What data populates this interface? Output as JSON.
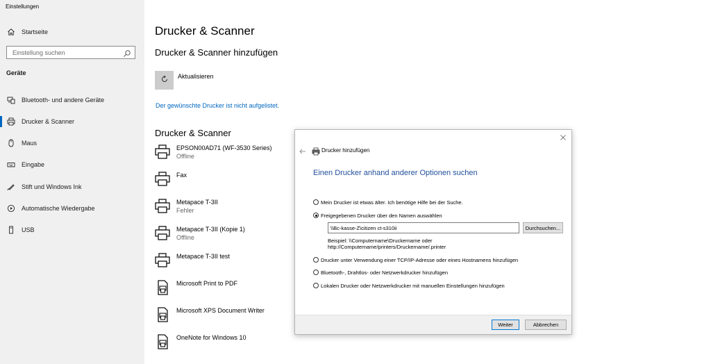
{
  "app": {
    "title": "Einstellungen"
  },
  "sidebar": {
    "home_label": "Startseite",
    "search_placeholder": "Einstellung suchen",
    "section": "Geräte",
    "items": [
      {
        "label": "Bluetooth- und andere Geräte",
        "icon": "bluetooth-devices-icon",
        "active": false
      },
      {
        "label": "Drucker & Scanner",
        "icon": "printer-icon",
        "active": true
      },
      {
        "label": "Maus",
        "icon": "mouse-icon",
        "active": false
      },
      {
        "label": "Eingabe",
        "icon": "keyboard-icon",
        "active": false
      },
      {
        "label": "Stift und Windows Ink",
        "icon": "pen-icon",
        "active": false
      },
      {
        "label": "Automatische Wiedergabe",
        "icon": "autoplay-icon",
        "active": false
      },
      {
        "label": "USB",
        "icon": "usb-icon",
        "active": false
      }
    ]
  },
  "main": {
    "title": "Drucker & Scanner",
    "add_title": "Drucker & Scanner hinzufügen",
    "refresh_label": "Aktualisieren",
    "not_listed_link": "Der gewünschte Drucker ist nicht aufgelistet.",
    "list_title": "Drucker & Scanner",
    "printers": [
      {
        "name": "EPSON00AD71 (WF-3530 Series)",
        "status": "Offline",
        "icon": "printer-icon"
      },
      {
        "name": "Fax",
        "status": "",
        "icon": "printer-icon"
      },
      {
        "name": "Metapace T-3II",
        "status": "Fehler",
        "icon": "printer-icon"
      },
      {
        "name": "Metapace T-3II (Kopie 1)",
        "status": "Offline",
        "icon": "printer-icon"
      },
      {
        "name": "Metapace T-3II test",
        "status": "",
        "icon": "printer-icon"
      },
      {
        "name": "Microsoft Print to PDF",
        "status": "",
        "icon": "document-printer-icon"
      },
      {
        "name": "Microsoft XPS Document Writer",
        "status": "",
        "icon": "document-printer-icon"
      },
      {
        "name": "OneNote for Windows 10",
        "status": "",
        "icon": "document-printer-icon"
      }
    ]
  },
  "dialog": {
    "title": "Drucker hinzufügen",
    "heading": "Einen Drucker anhand anderer Optionen suchen",
    "options": [
      {
        "label": "Mein Drucker ist etwas älter. Ich benötige Hilfe bei der Suche.",
        "checked": false
      },
      {
        "label": "Freigegebenen Drucker über den Namen auswählen",
        "checked": true
      },
      {
        "label": "Drucker unter Verwendung einer TCP/IP-Adresse oder eines Hostnamens hinzufügen",
        "checked": false
      },
      {
        "label": "Bluetooth-, Drahtlos- oder Netzwerkdrucker hinzufügen",
        "checked": false
      },
      {
        "label": "Lokalen Drucker oder Netzwerkdrucker mit manuellen Einstellungen hinzufügen",
        "checked": false
      }
    ],
    "path_value": "\\\\Bc-kasse-Z\\citizen ct-s310ii",
    "browse_label": "Durchsuchen...",
    "example_line1": "Beispiel: \\\\Computername\\Druckername oder",
    "example_line2": "http://Computername/printers/Druckername/.printer",
    "next_label": "Weiter",
    "cancel_label": "Abbrechen"
  }
}
